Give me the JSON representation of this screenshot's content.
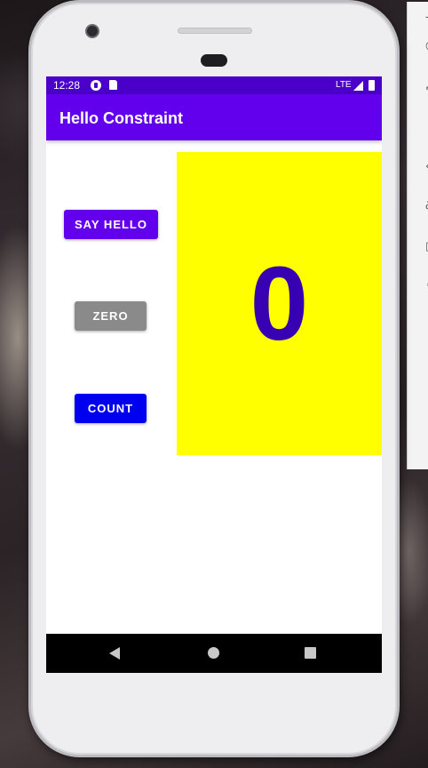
{
  "status_bar": {
    "time": "12:28",
    "network": "LTE",
    "icons": [
      "play-protect-icon",
      "sd-card-icon",
      "signal-icon",
      "battery-icon"
    ]
  },
  "app_bar": {
    "title": "Hello Constraint"
  },
  "buttons": {
    "say_hello": "SAY HELLO",
    "zero": "ZERO",
    "count": "COUNT"
  },
  "counter": {
    "value": "0"
  },
  "nav_bar": {
    "icons": [
      "back-icon",
      "home-icon",
      "recents-icon"
    ]
  },
  "colors": {
    "status_bar": "#4a00c8",
    "app_bar": "#6200ee",
    "count_panel": "#ffff00",
    "count_text": "#3700b3",
    "say_hello_button": "#6200ee",
    "zero_button": "#8a8a8a",
    "count_button": "#0000f0"
  }
}
